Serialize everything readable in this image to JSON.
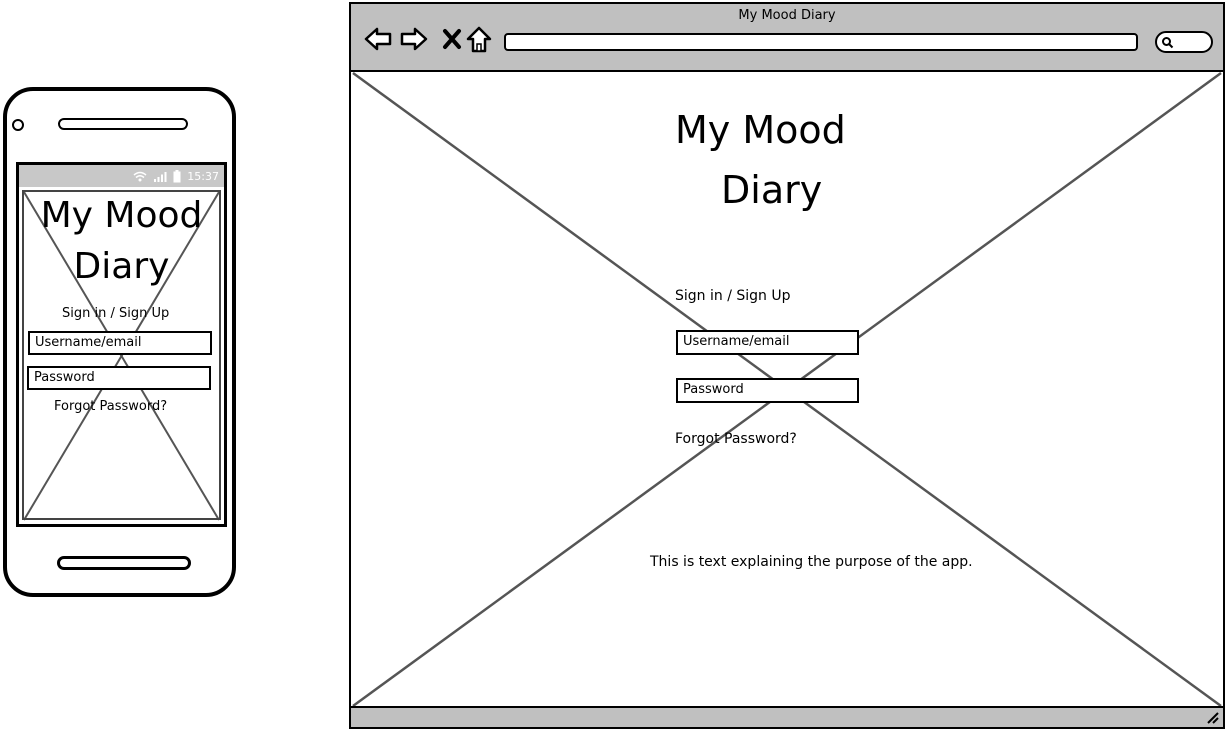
{
  "mobile": {
    "status": {
      "time": "15:37"
    },
    "title_line1": "My Mood",
    "title_line2": "Diary",
    "sign_in_label": "Sign in / Sign Up",
    "username_placeholder": "Username/email",
    "password_placeholder": "Password",
    "forgot_password": "Forgot Password?"
  },
  "browser": {
    "window_title": "My Mood Diary",
    "nav_icons": [
      "back-arrow-icon",
      "forward-arrow-icon",
      "close-x-icon",
      "home-icon"
    ],
    "page": {
      "title_line1": "My Mood",
      "title_line2": "Diary",
      "sign_in_label": "Sign in / Sign Up",
      "username_placeholder": "Username/email",
      "password_placeholder": "Password",
      "forgot_password": "Forgot Password?",
      "description": "This is text explaining the purpose of the app."
    }
  },
  "colors": {
    "chrome_gray": "#c0c0c0",
    "status_gray": "#c8c8c8",
    "placeholder_x": "#555555"
  }
}
